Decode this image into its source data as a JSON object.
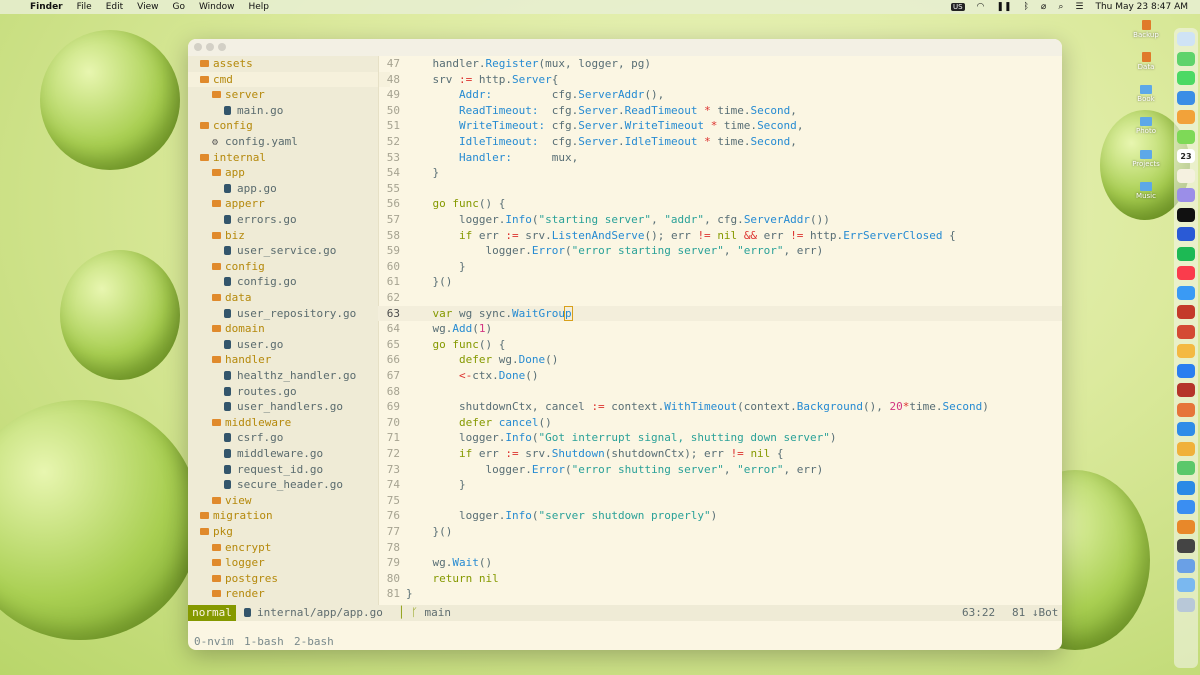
{
  "menubar": {
    "app": "Finder",
    "items": [
      "File",
      "Edit",
      "View",
      "Go",
      "Window",
      "Help"
    ],
    "input_source": "US",
    "datetime": "Thu May 23  8:47 AM"
  },
  "desktop": {
    "items": [
      "Backup",
      "Data",
      "Book",
      "Photo",
      "Projects",
      "Music"
    ]
  },
  "dock": {
    "calendar_day": "23"
  },
  "sidebar": {
    "tree": [
      {
        "label": "assets",
        "type": "dir",
        "depth": 0
      },
      {
        "label": "cmd",
        "type": "dir",
        "depth": 0
      },
      {
        "label": "server",
        "type": "dir",
        "depth": 1
      },
      {
        "label": "main.go",
        "type": "file",
        "depth": 2
      },
      {
        "label": "config",
        "type": "dir",
        "depth": 0
      },
      {
        "label": "config.yaml",
        "type": "gear",
        "depth": 1
      },
      {
        "label": "internal",
        "type": "dir",
        "depth": 0
      },
      {
        "label": "app",
        "type": "dir",
        "depth": 1
      },
      {
        "label": "app.go",
        "type": "file",
        "depth": 2
      },
      {
        "label": "apperr",
        "type": "dir",
        "depth": 1
      },
      {
        "label": "errors.go",
        "type": "file",
        "depth": 2
      },
      {
        "label": "biz",
        "type": "dir",
        "depth": 1
      },
      {
        "label": "user_service.go",
        "type": "file",
        "depth": 2
      },
      {
        "label": "config",
        "type": "dir",
        "depth": 1
      },
      {
        "label": "config.go",
        "type": "file",
        "depth": 2
      },
      {
        "label": "data",
        "type": "dir",
        "depth": 1
      },
      {
        "label": "user_repository.go",
        "type": "file",
        "depth": 2
      },
      {
        "label": "domain",
        "type": "dir",
        "depth": 1
      },
      {
        "label": "user.go",
        "type": "file",
        "depth": 2
      },
      {
        "label": "handler",
        "type": "dir",
        "depth": 1
      },
      {
        "label": "healthz_handler.go",
        "type": "file",
        "depth": 2
      },
      {
        "label": "routes.go",
        "type": "file",
        "depth": 2
      },
      {
        "label": "user_handlers.go",
        "type": "file",
        "depth": 2
      },
      {
        "label": "middleware",
        "type": "dir",
        "depth": 1
      },
      {
        "label": "csrf.go",
        "type": "file",
        "depth": 2
      },
      {
        "label": "middleware.go",
        "type": "file",
        "depth": 2
      },
      {
        "label": "request_id.go",
        "type": "file",
        "depth": 2
      },
      {
        "label": "secure_header.go",
        "type": "file",
        "depth": 2
      },
      {
        "label": "view",
        "type": "dir",
        "depth": 1
      },
      {
        "label": "migration",
        "type": "dir",
        "depth": 0
      },
      {
        "label": "pkg",
        "type": "dir",
        "depth": 0
      },
      {
        "label": "encrypt",
        "type": "dir",
        "depth": 1
      },
      {
        "label": "logger",
        "type": "dir",
        "depth": 1
      },
      {
        "label": "postgres",
        "type": "dir",
        "depth": 1
      },
      {
        "label": "render",
        "type": "dir",
        "depth": 1
      }
    ]
  },
  "editor": {
    "current_line": 63,
    "lines": [
      {
        "n": "47",
        "t": [
          [
            "    handler.",
            ""
          ],
          [
            "Register",
            "fn"
          ],
          [
            "(mux, logger, pg)",
            ""
          ]
        ]
      },
      {
        "n": "48",
        "t": [
          [
            "    srv ",
            ""
          ],
          [
            ":=",
            "op"
          ],
          [
            " http.",
            ""
          ],
          [
            "Server",
            "fn"
          ],
          [
            "{",
            ""
          ]
        ]
      },
      {
        "n": "49",
        "t": [
          [
            "        ",
            ""
          ],
          [
            "Addr:",
            "fld"
          ],
          [
            "         cfg.",
            ""
          ],
          [
            "ServerAddr",
            "fn"
          ],
          [
            "(),",
            ""
          ]
        ]
      },
      {
        "n": "50",
        "t": [
          [
            "        ",
            ""
          ],
          [
            "ReadTimeout:",
            "fld"
          ],
          [
            "  cfg.",
            ""
          ],
          [
            "Server",
            "fn"
          ],
          [
            ".",
            ""
          ],
          [
            "ReadTimeout",
            "fn"
          ],
          [
            " ",
            ""
          ],
          [
            "*",
            "op"
          ],
          [
            " time.",
            ""
          ],
          [
            "Second",
            "fn"
          ],
          [
            ",",
            ""
          ]
        ]
      },
      {
        "n": "51",
        "t": [
          [
            "        ",
            ""
          ],
          [
            "WriteTimeout:",
            "fld"
          ],
          [
            " cfg.",
            ""
          ],
          [
            "Server",
            "fn"
          ],
          [
            ".",
            ""
          ],
          [
            "WriteTimeout",
            "fn"
          ],
          [
            " ",
            ""
          ],
          [
            "*",
            "op"
          ],
          [
            " time.",
            ""
          ],
          [
            "Second",
            "fn"
          ],
          [
            ",",
            ""
          ]
        ]
      },
      {
        "n": "52",
        "t": [
          [
            "        ",
            ""
          ],
          [
            "IdleTimeout:",
            "fld"
          ],
          [
            "  cfg.",
            ""
          ],
          [
            "Server",
            "fn"
          ],
          [
            ".",
            ""
          ],
          [
            "IdleTimeout",
            "fn"
          ],
          [
            " ",
            ""
          ],
          [
            "*",
            "op"
          ],
          [
            " time.",
            ""
          ],
          [
            "Second",
            "fn"
          ],
          [
            ",",
            ""
          ]
        ]
      },
      {
        "n": "53",
        "t": [
          [
            "        ",
            ""
          ],
          [
            "Handler:",
            "fld"
          ],
          [
            "      mux,",
            ""
          ]
        ]
      },
      {
        "n": "54",
        "t": [
          [
            "    }",
            ""
          ]
        ]
      },
      {
        "n": "55",
        "t": [
          [
            "",
            ""
          ]
        ]
      },
      {
        "n": "56",
        "t": [
          [
            "    ",
            ""
          ],
          [
            "go",
            "kw"
          ],
          [
            " ",
            ""
          ],
          [
            "func",
            "kw"
          ],
          [
            "() {",
            ""
          ]
        ]
      },
      {
        "n": "57",
        "t": [
          [
            "        logger.",
            ""
          ],
          [
            "Info",
            "fn"
          ],
          [
            "(",
            ""
          ],
          [
            "\"starting server\"",
            "st"
          ],
          [
            ", ",
            ""
          ],
          [
            "\"addr\"",
            "st"
          ],
          [
            ", cfg.",
            ""
          ],
          [
            "ServerAddr",
            "fn"
          ],
          [
            "())",
            ""
          ]
        ]
      },
      {
        "n": "58",
        "t": [
          [
            "        ",
            ""
          ],
          [
            "if",
            "kw"
          ],
          [
            " err ",
            ""
          ],
          [
            ":=",
            "op"
          ],
          [
            " srv.",
            ""
          ],
          [
            "ListenAndServe",
            "fn"
          ],
          [
            "(); err ",
            ""
          ],
          [
            "!=",
            "op"
          ],
          [
            " ",
            ""
          ],
          [
            "nil",
            "kw"
          ],
          [
            " ",
            ""
          ],
          [
            "&&",
            "op"
          ],
          [
            " err ",
            ""
          ],
          [
            "!=",
            "op"
          ],
          [
            " http.",
            ""
          ],
          [
            "ErrServerClosed",
            "fn"
          ],
          [
            " {",
            ""
          ]
        ]
      },
      {
        "n": "59",
        "t": [
          [
            "            logger.",
            ""
          ],
          [
            "Error",
            "fn"
          ],
          [
            "(",
            ""
          ],
          [
            "\"error starting server\"",
            "st"
          ],
          [
            ", ",
            ""
          ],
          [
            "\"error\"",
            "st"
          ],
          [
            ", err)",
            ""
          ]
        ]
      },
      {
        "n": "60",
        "t": [
          [
            "        }",
            ""
          ]
        ]
      },
      {
        "n": "61",
        "t": [
          [
            "    }()",
            ""
          ]
        ]
      },
      {
        "n": "62",
        "t": [
          [
            "",
            ""
          ]
        ]
      },
      {
        "n": "63",
        "t": [
          [
            "    ",
            ""
          ],
          [
            "var",
            "kw"
          ],
          [
            " wg sync.",
            ""
          ],
          [
            "WaitGroup",
            "fn"
          ]
        ]
      },
      {
        "n": "64",
        "t": [
          [
            "    wg.",
            ""
          ],
          [
            "Add",
            "fn"
          ],
          [
            "(",
            ""
          ],
          [
            "1",
            "nm"
          ],
          [
            ")",
            ""
          ]
        ]
      },
      {
        "n": "65",
        "t": [
          [
            "    ",
            ""
          ],
          [
            "go",
            "kw"
          ],
          [
            " ",
            ""
          ],
          [
            "func",
            "kw"
          ],
          [
            "() {",
            ""
          ]
        ]
      },
      {
        "n": "66",
        "t": [
          [
            "        ",
            ""
          ],
          [
            "defer",
            "kw"
          ],
          [
            " wg.",
            ""
          ],
          [
            "Done",
            "fn"
          ],
          [
            "()",
            ""
          ]
        ]
      },
      {
        "n": "67",
        "t": [
          [
            "        ",
            ""
          ],
          [
            "<-",
            "op"
          ],
          [
            "ctx.",
            ""
          ],
          [
            "Done",
            "fn"
          ],
          [
            "()",
            ""
          ]
        ]
      },
      {
        "n": "68",
        "t": [
          [
            "",
            ""
          ]
        ]
      },
      {
        "n": "69",
        "t": [
          [
            "        shutdownCtx, cancel ",
            ""
          ],
          [
            ":=",
            "op"
          ],
          [
            " context.",
            ""
          ],
          [
            "WithTimeout",
            "fn"
          ],
          [
            "(context.",
            ""
          ],
          [
            "Background",
            "fn"
          ],
          [
            "(), ",
            ""
          ],
          [
            "20",
            "nm"
          ],
          [
            "*",
            "op"
          ],
          [
            "time.",
            ""
          ],
          [
            "Second",
            "fn"
          ],
          [
            ")",
            ""
          ]
        ]
      },
      {
        "n": "70",
        "t": [
          [
            "        ",
            ""
          ],
          [
            "defer",
            "kw"
          ],
          [
            " ",
            ""
          ],
          [
            "cancel",
            "fn"
          ],
          [
            "()",
            ""
          ]
        ]
      },
      {
        "n": "71",
        "t": [
          [
            "        logger.",
            ""
          ],
          [
            "Info",
            "fn"
          ],
          [
            "(",
            ""
          ],
          [
            "\"Got interrupt signal, shutting down server\"",
            "st"
          ],
          [
            ")",
            ""
          ]
        ]
      },
      {
        "n": "72",
        "t": [
          [
            "        ",
            ""
          ],
          [
            "if",
            "kw"
          ],
          [
            " err ",
            ""
          ],
          [
            ":=",
            "op"
          ],
          [
            " srv.",
            ""
          ],
          [
            "Shutdown",
            "fn"
          ],
          [
            "(shutdownCtx); err ",
            ""
          ],
          [
            "!=",
            "op"
          ],
          [
            " ",
            ""
          ],
          [
            "nil",
            "kw"
          ],
          [
            " {",
            ""
          ]
        ]
      },
      {
        "n": "73",
        "t": [
          [
            "            logger.",
            ""
          ],
          [
            "Error",
            "fn"
          ],
          [
            "(",
            ""
          ],
          [
            "\"error shutting server\"",
            "st"
          ],
          [
            ", ",
            ""
          ],
          [
            "\"error\"",
            "st"
          ],
          [
            ", err)",
            ""
          ]
        ]
      },
      {
        "n": "74",
        "t": [
          [
            "        }",
            ""
          ]
        ]
      },
      {
        "n": "75",
        "t": [
          [
            "",
            ""
          ]
        ]
      },
      {
        "n": "76",
        "t": [
          [
            "        logger.",
            ""
          ],
          [
            "Info",
            "fn"
          ],
          [
            "(",
            ""
          ],
          [
            "\"server shutdown properly\"",
            "st"
          ],
          [
            ")",
            ""
          ]
        ]
      },
      {
        "n": "77",
        "t": [
          [
            "    }()",
            ""
          ]
        ]
      },
      {
        "n": "78",
        "t": [
          [
            "",
            ""
          ]
        ]
      },
      {
        "n": "79",
        "t": [
          [
            "    wg.",
            ""
          ],
          [
            "Wait",
            "fn"
          ],
          [
            "()",
            ""
          ]
        ]
      },
      {
        "n": "80",
        "t": [
          [
            "    ",
            ""
          ],
          [
            "return",
            "kw"
          ],
          [
            " ",
            ""
          ],
          [
            "nil",
            "kw"
          ]
        ]
      },
      {
        "n": "81",
        "t": [
          [
            "}",
            ""
          ]
        ]
      }
    ]
  },
  "statusline": {
    "mode": "normal",
    "file": "internal/app/app.go",
    "branch": "main",
    "position": "63:22",
    "percent": "81 ↓Bot"
  },
  "tmux": {
    "windows": [
      "0-nvim",
      "1-bash",
      "2-bash"
    ]
  }
}
